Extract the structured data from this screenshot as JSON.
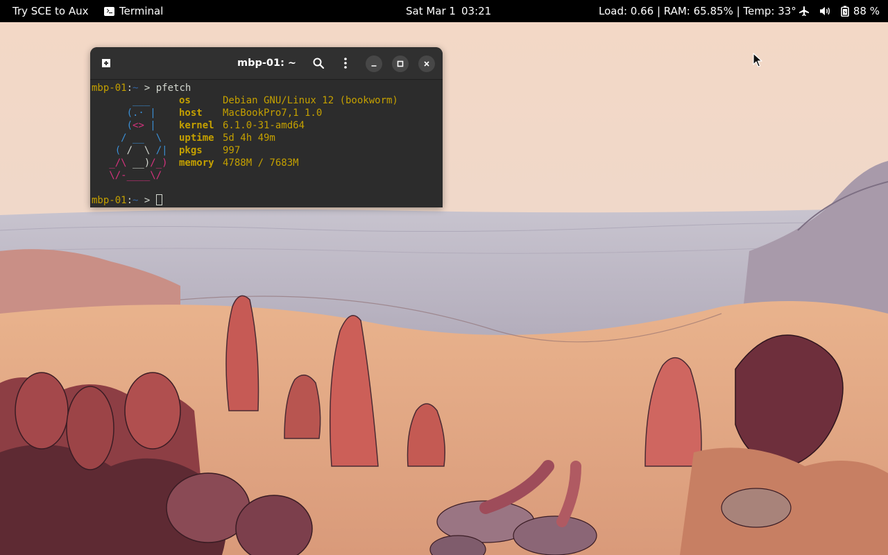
{
  "topbar": {
    "activities": "Try SCE to Aux",
    "app_name": "Terminal",
    "clock_date": "Sat Mar 1",
    "clock_time": "03:21",
    "sysmon": "Load: 0.66  |  RAM:  65.85%  |  Temp: 33°",
    "battery_label": "88 %",
    "icons": [
      "terminal-app-icon",
      "airplane-icon",
      "volume-icon",
      "battery-icon"
    ]
  },
  "terminal": {
    "title": "mbp-01: ~",
    "prompt_host": "mbp-01",
    "prompt_sep": ":",
    "prompt_dir": "~",
    "prompt_arrow": " > ",
    "command": "pfetch",
    "pfetch": [
      {
        "label": "os",
        "value": "Debian GNU/Linux 12 (bookworm)"
      },
      {
        "label": "host",
        "value": "MacBookPro7,1 1.0"
      },
      {
        "label": "kernel",
        "value": "6.1.0-31-amd64"
      },
      {
        "label": "uptime",
        "value": "5d 4h 49m"
      },
      {
        "label": "pkgs",
        "value": "997"
      },
      {
        "label": "memory",
        "value": "4788M / 7683M"
      }
    ],
    "ascii_art": [
      "       ___",
      "      (.· |",
      "      (<> |",
      "     / __  \\",
      "    ( /  \\ /|",
      "   _/\\ __)/_)",
      "   \\/-____\\/"
    ]
  },
  "colors": {
    "topbar_bg": "#000000",
    "terminal_bg": "#2c2c2c",
    "prompt_color": "#c4a000",
    "tux_blue": "#3b8fd5",
    "tux_pink": "#d6327e"
  }
}
